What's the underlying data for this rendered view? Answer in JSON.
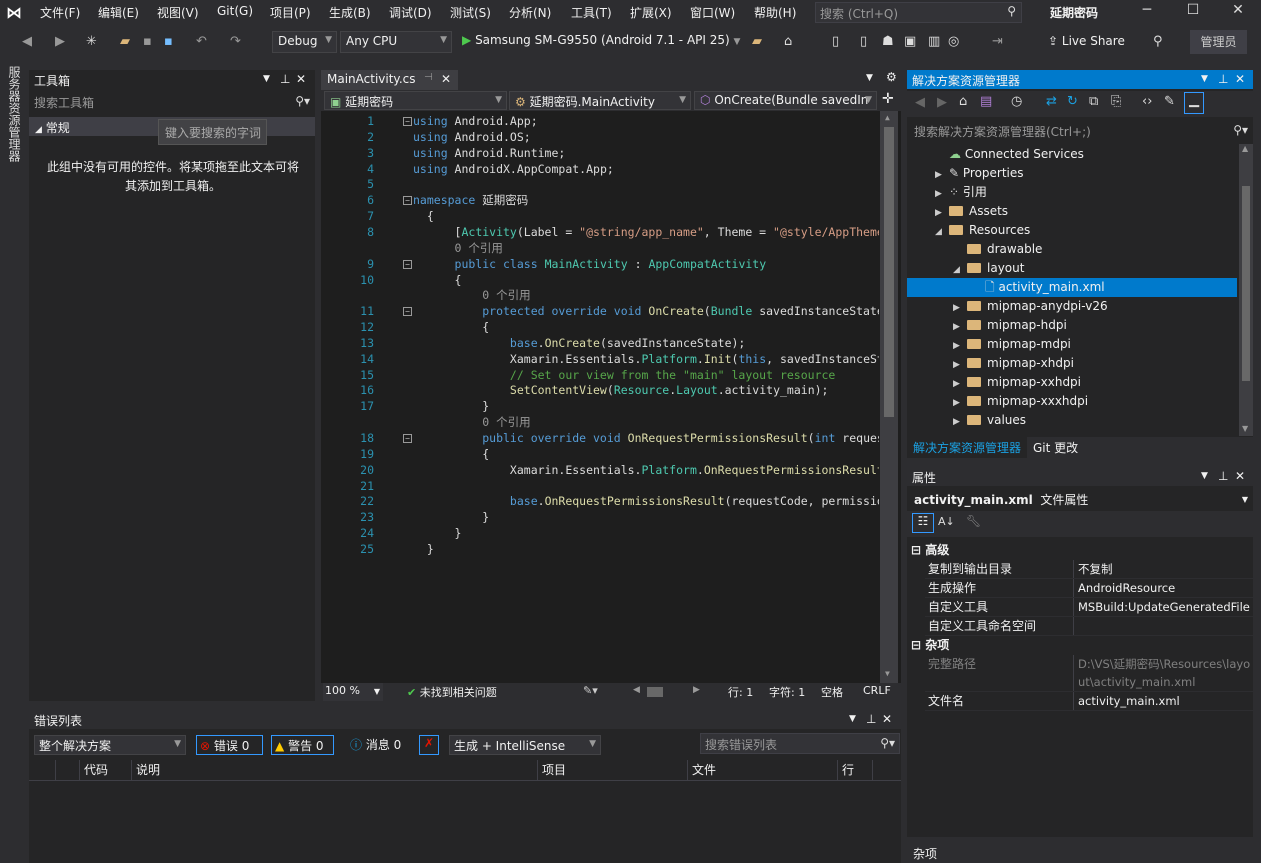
{
  "app": {
    "title": "延期密码",
    "search_placeholder": "搜索 (Ctrl+Q)",
    "user_badge": "管理员",
    "live_share": "Live Share"
  },
  "menu": [
    "文件(F)",
    "编辑(E)",
    "视图(V)",
    "Git(G)",
    "项目(P)",
    "生成(B)",
    "调试(D)",
    "测试(S)",
    "分析(N)",
    "工具(T)",
    "扩展(X)",
    "窗口(W)",
    "帮助(H)"
  ],
  "toolbar": {
    "config": "Debug",
    "platform": "Any CPU",
    "run_target": "Samsung SM-G9550 (Android 7.1 - API 25)"
  },
  "left_strip": {
    "label": "服务器资源管理器"
  },
  "toolbox": {
    "title": "工具箱",
    "search_placeholder": "搜索工具箱",
    "group": "常规",
    "empty_message": "此组中没有可用的控件。将某项拖至此文本可将其添加到工具箱。",
    "tooltip": "键入要搜索的字词"
  },
  "editor": {
    "tab": "MainActivity.cs",
    "nav": {
      "project": "延期密码",
      "class": "延期密码.MainActivity",
      "member": "OnCreate(Bundle savedIn"
    },
    "lines": [
      {
        "n": "1",
        "t": [
          [
            "kw",
            "using"
          ],
          [
            "tx",
            " Android.App;"
          ]
        ]
      },
      {
        "n": "2",
        "t": [
          [
            "kw",
            "using"
          ],
          [
            "tx",
            " Android.OS;"
          ]
        ]
      },
      {
        "n": "3",
        "t": [
          [
            "kw",
            "using"
          ],
          [
            "tx",
            " Android.Runtime;"
          ]
        ]
      },
      {
        "n": "4",
        "t": [
          [
            "kw",
            "using"
          ],
          [
            "tx",
            " AndroidX.AppCompat.App;"
          ]
        ]
      },
      {
        "n": "5",
        "t": []
      },
      {
        "n": "6",
        "t": [
          [
            "kw",
            "namespace"
          ],
          [
            "tx",
            " 延期密码"
          ]
        ]
      },
      {
        "n": "7",
        "t": [
          [
            "tx",
            "  {"
          ]
        ]
      },
      {
        "n": "8",
        "t": [
          [
            "tx",
            "      ["
          ],
          [
            "ty",
            "Activity"
          ],
          [
            "tx",
            "(Label = "
          ],
          [
            "st",
            "\"@string/app_name\""
          ],
          [
            "tx",
            ", Theme = "
          ],
          [
            "st",
            "\"@style/AppTheme"
          ]
        ]
      },
      {
        "n": "",
        "t": [
          [
            "lens",
            "      0 个引用"
          ]
        ]
      },
      {
        "n": "9",
        "t": [
          [
            "kw",
            "      public class "
          ],
          [
            "ty",
            "MainActivity"
          ],
          [
            "tx",
            " : "
          ],
          [
            "ty",
            "AppCompatActivity"
          ]
        ]
      },
      {
        "n": "10",
        "t": [
          [
            "tx",
            "      {"
          ]
        ]
      },
      {
        "n": "",
        "t": [
          [
            "lens",
            "          0 个引用"
          ]
        ]
      },
      {
        "n": "11",
        "t": [
          [
            "kw",
            "          protected override void "
          ],
          [
            "fn",
            "OnCreate"
          ],
          [
            "tx",
            "("
          ],
          [
            "ty",
            "Bundle"
          ],
          [
            "tx",
            " savedInstanceState"
          ]
        ]
      },
      {
        "n": "12",
        "t": [
          [
            "tx",
            "          {"
          ]
        ]
      },
      {
        "n": "13",
        "t": [
          [
            "kw",
            "              base"
          ],
          [
            "tx",
            "."
          ],
          [
            "fn",
            "OnCreate"
          ],
          [
            "tx",
            "(savedInstanceState);"
          ]
        ]
      },
      {
        "n": "14",
        "t": [
          [
            "tx",
            "              Xamarin.Essentials."
          ],
          [
            "ty",
            "Platform"
          ],
          [
            "tx",
            "."
          ],
          [
            "fn",
            "Init"
          ],
          [
            "tx",
            "("
          ],
          [
            "kw",
            "this"
          ],
          [
            "tx",
            ", savedInstanceSt"
          ]
        ]
      },
      {
        "n": "15",
        "t": [
          [
            "cm",
            "              // Set our view from the \"main\" layout resource"
          ]
        ]
      },
      {
        "n": "16",
        "t": [
          [
            "fn",
            "              SetContentView"
          ],
          [
            "tx",
            "("
          ],
          [
            "ty",
            "Resource"
          ],
          [
            "tx",
            "."
          ],
          [
            "ty",
            "Layout"
          ],
          [
            "tx",
            ".activity_main);"
          ]
        ]
      },
      {
        "n": "17",
        "t": [
          [
            "tx",
            "          }"
          ]
        ]
      },
      {
        "n": "",
        "t": [
          [
            "lens",
            "          0 个引用"
          ]
        ]
      },
      {
        "n": "18",
        "t": [
          [
            "kw",
            "          public override void "
          ],
          [
            "fn",
            "OnRequestPermissionsResult"
          ],
          [
            "tx",
            "("
          ],
          [
            "kw",
            "int"
          ],
          [
            "tx",
            " request"
          ]
        ]
      },
      {
        "n": "19",
        "t": [
          [
            "tx",
            "          {"
          ]
        ]
      },
      {
        "n": "20",
        "t": [
          [
            "tx",
            "              Xamarin.Essentials."
          ],
          [
            "ty",
            "Platform"
          ],
          [
            "tx",
            "."
          ],
          [
            "fn",
            "OnRequestPermissionsResult"
          ]
        ]
      },
      {
        "n": "21",
        "t": []
      },
      {
        "n": "22",
        "t": [
          [
            "kw",
            "              base"
          ],
          [
            "tx",
            "."
          ],
          [
            "fn",
            "OnRequestPermissionsResult"
          ],
          [
            "tx",
            "(requestCode, permissio"
          ]
        ]
      },
      {
        "n": "23",
        "t": [
          [
            "tx",
            "          }"
          ]
        ]
      },
      {
        "n": "24",
        "t": [
          [
            "tx",
            "      }"
          ]
        ]
      },
      {
        "n": "25",
        "t": [
          [
            "tx",
            "  }"
          ]
        ]
      }
    ],
    "status": {
      "zoom": "100 %",
      "issues": "未找到相关问题",
      "line": "行: 1",
      "char": "字符: 1",
      "spaces": "空格",
      "eol": "CRLF"
    }
  },
  "error_list": {
    "title": "错误列表",
    "scope": "整个解决方案",
    "errors": "错误 0",
    "warnings": "警告 0",
    "messages": "消息 0",
    "source": "生成 + IntelliSense",
    "search_placeholder": "搜索错误列表",
    "columns": [
      "代码",
      "说明",
      "项目",
      "文件",
      "行"
    ]
  },
  "solution_explorer": {
    "title": "解决方案资源管理器",
    "search_placeholder": "搜索解决方案资源管理器(Ctrl+;)",
    "items": [
      {
        "label": "Connected Services",
        "depth": 1,
        "tw": "",
        "icon": "connected"
      },
      {
        "label": "Properties",
        "depth": 1,
        "tw": "▶",
        "icon": "wrench"
      },
      {
        "label": "引用",
        "depth": 1,
        "tw": "▶",
        "icon": "refs"
      },
      {
        "label": "Assets",
        "depth": 1,
        "tw": "▶",
        "icon": "folder"
      },
      {
        "label": "Resources",
        "depth": 1,
        "tw": "◢",
        "icon": "folder"
      },
      {
        "label": "drawable",
        "depth": 2,
        "tw": "",
        "icon": "folder"
      },
      {
        "label": "layout",
        "depth": 2,
        "tw": "◢",
        "icon": "folder"
      },
      {
        "label": "activity_main.xml",
        "depth": 3,
        "tw": "",
        "icon": "file",
        "selected": true
      },
      {
        "label": "mipmap-anydpi-v26",
        "depth": 2,
        "tw": "▶",
        "icon": "folder"
      },
      {
        "label": "mipmap-hdpi",
        "depth": 2,
        "tw": "▶",
        "icon": "folder"
      },
      {
        "label": "mipmap-mdpi",
        "depth": 2,
        "tw": "▶",
        "icon": "folder"
      },
      {
        "label": "mipmap-xhdpi",
        "depth": 2,
        "tw": "▶",
        "icon": "folder"
      },
      {
        "label": "mipmap-xxhdpi",
        "depth": 2,
        "tw": "▶",
        "icon": "folder"
      },
      {
        "label": "mipmap-xxxhdpi",
        "depth": 2,
        "tw": "▶",
        "icon": "folder"
      },
      {
        "label": "values",
        "depth": 2,
        "tw": "▶",
        "icon": "folder"
      }
    ],
    "tabs": [
      "解决方案资源管理器",
      "Git 更改"
    ]
  },
  "properties": {
    "title": "属性",
    "object": "activity_main.xml",
    "object_type": "文件属性",
    "cat1": "高级",
    "cat2": "杂项",
    "rows1": [
      {
        "k": "复制到输出目录",
        "v": "不复制"
      },
      {
        "k": "生成操作",
        "v": "AndroidResource"
      },
      {
        "k": "自定义工具",
        "v": "MSBuild:UpdateGeneratedFile"
      },
      {
        "k": "自定义工具命名空间",
        "v": ""
      }
    ],
    "rows2": [
      {
        "k": "完整路径",
        "v": "D:\\VS\\延期密码\\Resources\\layout\\activity_main.xml",
        "dim": true
      },
      {
        "k": "文件名",
        "v": "activity_main.xml"
      }
    ],
    "footer": "杂项"
  },
  "colors": {
    "accent": "#007acc",
    "bg": "#2d2d30",
    "panel": "#252526",
    "editor": "#1e1e1e"
  }
}
